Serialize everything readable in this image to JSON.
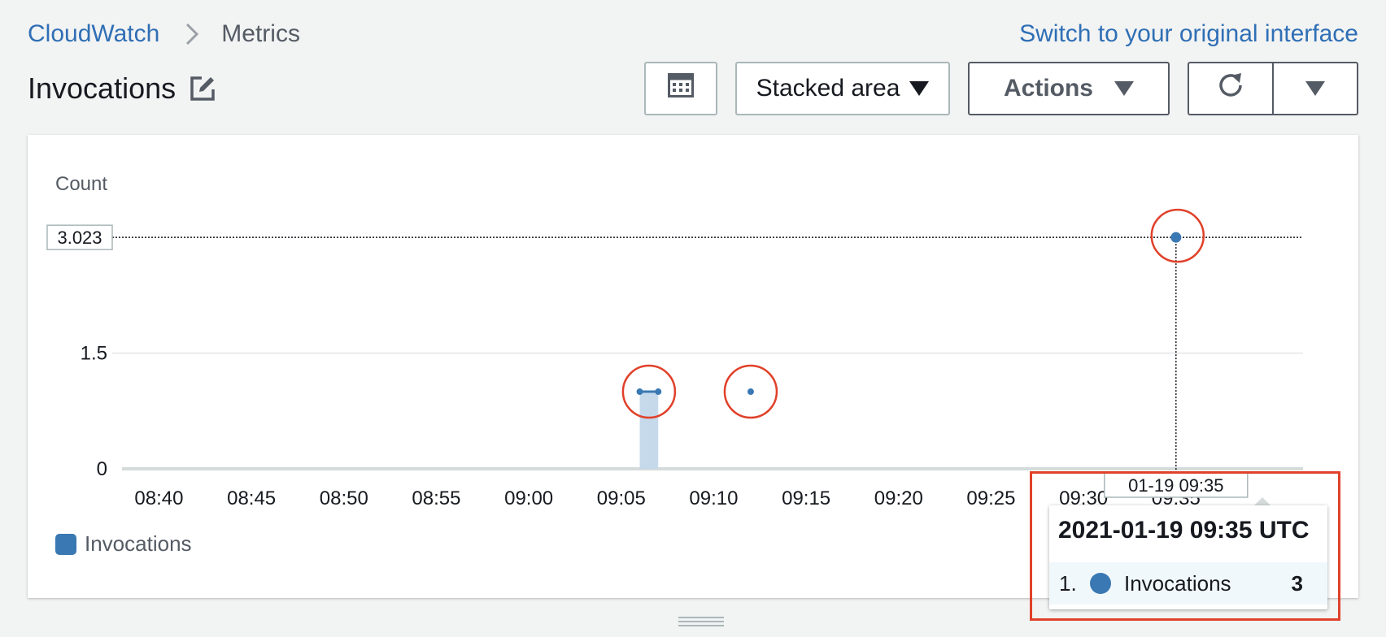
{
  "breadcrumb": {
    "root": "CloudWatch",
    "current": "Metrics"
  },
  "header": {
    "switch_link": "Switch to your original interface",
    "title": "Invocations"
  },
  "toolbar": {
    "calculator_icon": "calculator-icon",
    "chart_type": "Stacked area",
    "actions": "Actions",
    "refresh_icon": "refresh-icon"
  },
  "chart_data": {
    "type": "area",
    "stacked": true,
    "ylabel": "Count",
    "y_ticks": [
      "0",
      "1.5"
    ],
    "ylim": [
      0,
      3.023
    ],
    "x_ticks": [
      "08:40",
      "08:45",
      "08:50",
      "08:55",
      "09:00",
      "09:05",
      "09:10",
      "09:15",
      "09:20",
      "09:25",
      "09:30",
      "09:35"
    ],
    "x_start": "08:38",
    "x_end": "09:38",
    "hover_value_label": "3.023",
    "hover_time_label": "01-19 09:35",
    "series": [
      {
        "name": "Invocations",
        "color": "#3a78b3",
        "points": [
          {
            "x": "09:06",
            "y": 1
          },
          {
            "x": "09:07",
            "y": 1
          },
          {
            "x": "09:12",
            "y": 1
          },
          {
            "x": "09:35",
            "y": 3
          }
        ]
      }
    ],
    "legend": [
      {
        "name": "Invocations",
        "color": "#3a78b3"
      }
    ],
    "legend_position": "bottom-left",
    "grid": true
  },
  "tooltip": {
    "title": "2021-01-19 09:35 UTC",
    "rows": [
      {
        "index": "1.",
        "name": "Invocations",
        "value": "3"
      }
    ]
  },
  "colors": {
    "accent": "#2f6fb5",
    "series": "#3a78b3",
    "annotation": "#e0412a"
  }
}
